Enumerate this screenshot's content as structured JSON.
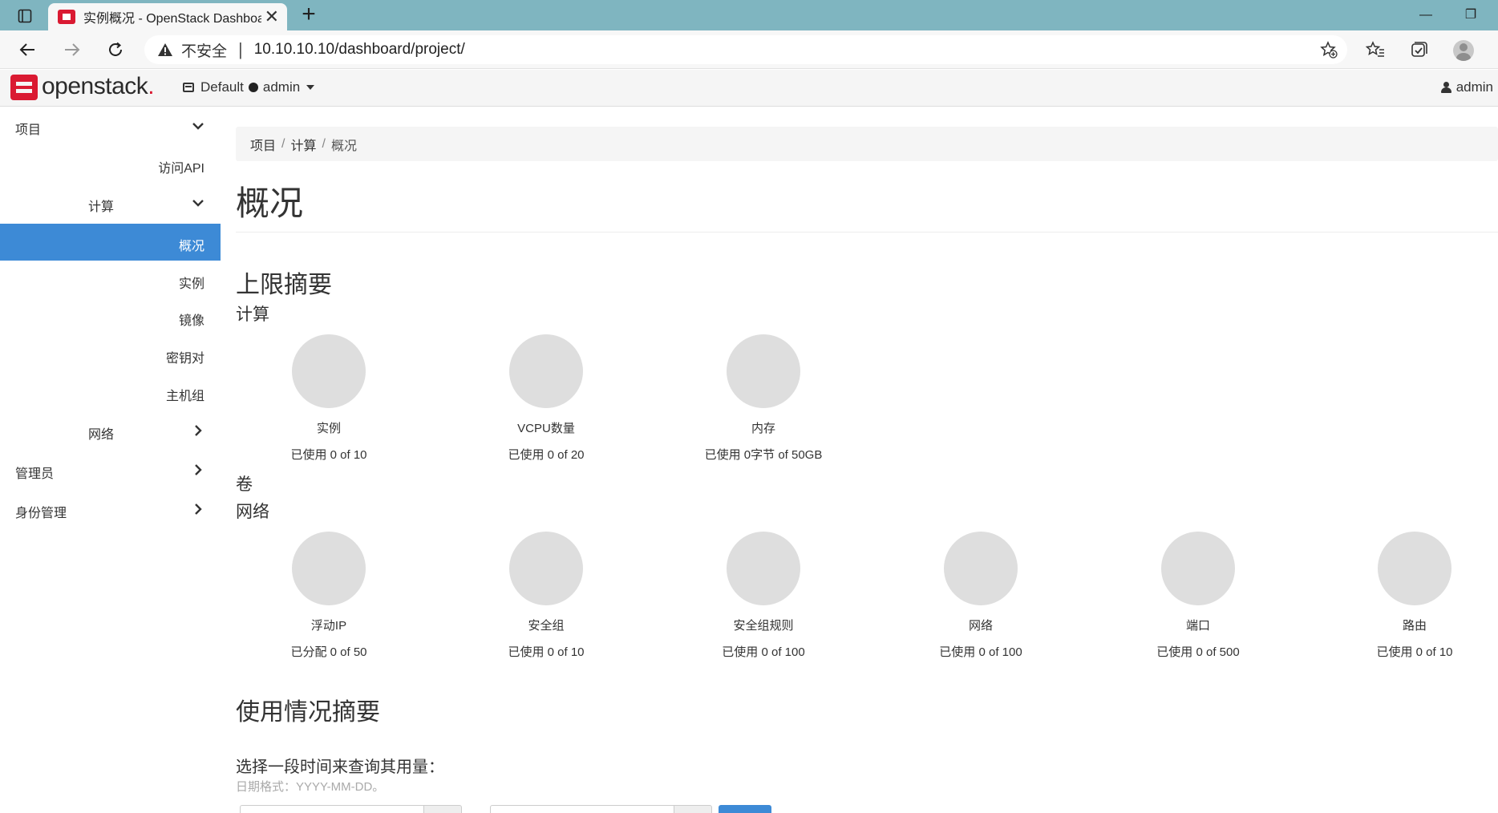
{
  "browser": {
    "tab_title": "实例概况 - OpenStack Dashboard",
    "tab_close": "✕",
    "new_tab": "+",
    "address": {
      "security_label": "不安全",
      "separator": "|",
      "url": "10.10.10.10/dashboard/project/"
    },
    "window_controls": {
      "minimize": "—",
      "restore": "❐"
    }
  },
  "header": {
    "logo_text": "openstack",
    "logo_dot": ".",
    "domain": "Default",
    "project": "admin",
    "user": "admin"
  },
  "sidebar": {
    "items": [
      {
        "label": "项目",
        "chevron": "down"
      },
      {
        "label": "访问API"
      },
      {
        "label": "计算",
        "chevron": "down"
      },
      {
        "label": "概况",
        "active": true
      },
      {
        "label": "实例"
      },
      {
        "label": "镜像"
      },
      {
        "label": "密钥对"
      },
      {
        "label": "主机组"
      },
      {
        "label": "网络",
        "chevron": "right"
      },
      {
        "label": "管理员",
        "chevron": "right"
      },
      {
        "label": "身份管理",
        "chevron": "right"
      }
    ]
  },
  "breadcrumb": {
    "items": [
      "项目",
      "计算",
      "概况"
    ],
    "separator": "/"
  },
  "page": {
    "title": "概况",
    "limit_summary": {
      "heading": "上限摘要",
      "compute": {
        "heading": "计算",
        "charts": [
          {
            "name": "实例",
            "usage": "已使用 0 of 10",
            "fraction": 0
          },
          {
            "name": "VCPU数量",
            "usage": "已使用 0 of 20",
            "fraction": 0
          },
          {
            "name": "内存",
            "usage": "已使用 0字节 of 50GB",
            "fraction": 0
          }
        ]
      },
      "volume": {
        "heading": "卷"
      },
      "network": {
        "heading": "网络",
        "charts": [
          {
            "name": "浮动IP",
            "usage": "已分配 0 of 50",
            "fraction": 0
          },
          {
            "name": "安全组",
            "usage": "已使用 0 of 10",
            "fraction": 0
          },
          {
            "name": "安全组规则",
            "usage": "已使用 0 of 100",
            "fraction": 0
          },
          {
            "name": "网络",
            "usage": "已使用 0 of 100",
            "fraction": 0
          },
          {
            "name": "端口",
            "usage": "已使用 0 of 500",
            "fraction": 0
          },
          {
            "name": "路由",
            "usage": "已使用 0 of 10",
            "fraction": 0
          }
        ]
      }
    },
    "usage_summary": {
      "heading": "使用情况摘要",
      "prompt": "选择一段时间来查询其用量：",
      "date_hint": "日期格式：YYYY-MM-DD。"
    }
  },
  "colors": {
    "accent": "#3d8ad6",
    "brand": "#da1a32",
    "pie_empty": "#dedede",
    "tabbar": "#7fb5c0"
  }
}
